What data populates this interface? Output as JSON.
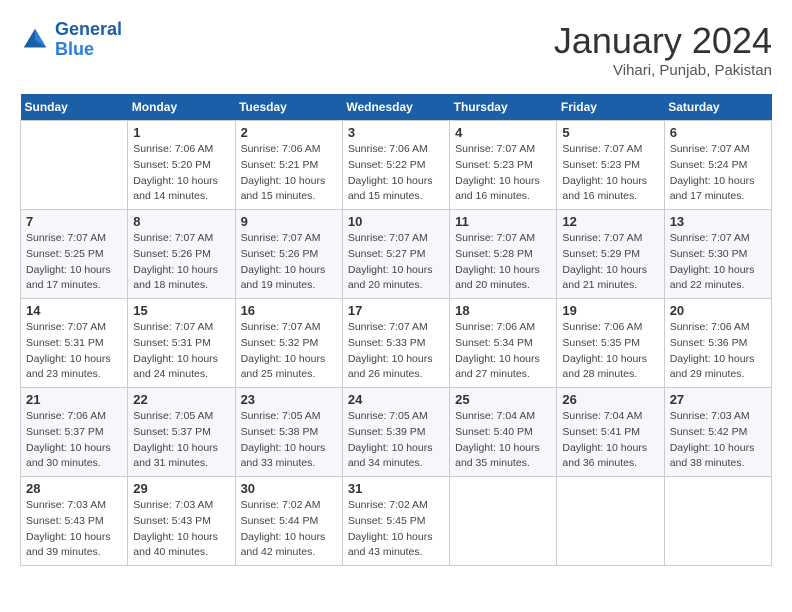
{
  "header": {
    "logo_line1": "General",
    "logo_line2": "Blue",
    "month_title": "January 2024",
    "subtitle": "Vihari, Punjab, Pakistan"
  },
  "days_of_week": [
    "Sunday",
    "Monday",
    "Tuesday",
    "Wednesday",
    "Thursday",
    "Friday",
    "Saturday"
  ],
  "weeks": [
    [
      {
        "day": "",
        "info": ""
      },
      {
        "day": "1",
        "info": "Sunrise: 7:06 AM\nSunset: 5:20 PM\nDaylight: 10 hours\nand 14 minutes."
      },
      {
        "day": "2",
        "info": "Sunrise: 7:06 AM\nSunset: 5:21 PM\nDaylight: 10 hours\nand 15 minutes."
      },
      {
        "day": "3",
        "info": "Sunrise: 7:06 AM\nSunset: 5:22 PM\nDaylight: 10 hours\nand 15 minutes."
      },
      {
        "day": "4",
        "info": "Sunrise: 7:07 AM\nSunset: 5:23 PM\nDaylight: 10 hours\nand 16 minutes."
      },
      {
        "day": "5",
        "info": "Sunrise: 7:07 AM\nSunset: 5:23 PM\nDaylight: 10 hours\nand 16 minutes."
      },
      {
        "day": "6",
        "info": "Sunrise: 7:07 AM\nSunset: 5:24 PM\nDaylight: 10 hours\nand 17 minutes."
      }
    ],
    [
      {
        "day": "7",
        "info": "Sunrise: 7:07 AM\nSunset: 5:25 PM\nDaylight: 10 hours\nand 17 minutes."
      },
      {
        "day": "8",
        "info": "Sunrise: 7:07 AM\nSunset: 5:26 PM\nDaylight: 10 hours\nand 18 minutes."
      },
      {
        "day": "9",
        "info": "Sunrise: 7:07 AM\nSunset: 5:26 PM\nDaylight: 10 hours\nand 19 minutes."
      },
      {
        "day": "10",
        "info": "Sunrise: 7:07 AM\nSunset: 5:27 PM\nDaylight: 10 hours\nand 20 minutes."
      },
      {
        "day": "11",
        "info": "Sunrise: 7:07 AM\nSunset: 5:28 PM\nDaylight: 10 hours\nand 20 minutes."
      },
      {
        "day": "12",
        "info": "Sunrise: 7:07 AM\nSunset: 5:29 PM\nDaylight: 10 hours\nand 21 minutes."
      },
      {
        "day": "13",
        "info": "Sunrise: 7:07 AM\nSunset: 5:30 PM\nDaylight: 10 hours\nand 22 minutes."
      }
    ],
    [
      {
        "day": "14",
        "info": "Sunrise: 7:07 AM\nSunset: 5:31 PM\nDaylight: 10 hours\nand 23 minutes."
      },
      {
        "day": "15",
        "info": "Sunrise: 7:07 AM\nSunset: 5:31 PM\nDaylight: 10 hours\nand 24 minutes."
      },
      {
        "day": "16",
        "info": "Sunrise: 7:07 AM\nSunset: 5:32 PM\nDaylight: 10 hours\nand 25 minutes."
      },
      {
        "day": "17",
        "info": "Sunrise: 7:07 AM\nSunset: 5:33 PM\nDaylight: 10 hours\nand 26 minutes."
      },
      {
        "day": "18",
        "info": "Sunrise: 7:06 AM\nSunset: 5:34 PM\nDaylight: 10 hours\nand 27 minutes."
      },
      {
        "day": "19",
        "info": "Sunrise: 7:06 AM\nSunset: 5:35 PM\nDaylight: 10 hours\nand 28 minutes."
      },
      {
        "day": "20",
        "info": "Sunrise: 7:06 AM\nSunset: 5:36 PM\nDaylight: 10 hours\nand 29 minutes."
      }
    ],
    [
      {
        "day": "21",
        "info": "Sunrise: 7:06 AM\nSunset: 5:37 PM\nDaylight: 10 hours\nand 30 minutes."
      },
      {
        "day": "22",
        "info": "Sunrise: 7:05 AM\nSunset: 5:37 PM\nDaylight: 10 hours\nand 31 minutes."
      },
      {
        "day": "23",
        "info": "Sunrise: 7:05 AM\nSunset: 5:38 PM\nDaylight: 10 hours\nand 33 minutes."
      },
      {
        "day": "24",
        "info": "Sunrise: 7:05 AM\nSunset: 5:39 PM\nDaylight: 10 hours\nand 34 minutes."
      },
      {
        "day": "25",
        "info": "Sunrise: 7:04 AM\nSunset: 5:40 PM\nDaylight: 10 hours\nand 35 minutes."
      },
      {
        "day": "26",
        "info": "Sunrise: 7:04 AM\nSunset: 5:41 PM\nDaylight: 10 hours\nand 36 minutes."
      },
      {
        "day": "27",
        "info": "Sunrise: 7:03 AM\nSunset: 5:42 PM\nDaylight: 10 hours\nand 38 minutes."
      }
    ],
    [
      {
        "day": "28",
        "info": "Sunrise: 7:03 AM\nSunset: 5:43 PM\nDaylight: 10 hours\nand 39 minutes."
      },
      {
        "day": "29",
        "info": "Sunrise: 7:03 AM\nSunset: 5:43 PM\nDaylight: 10 hours\nand 40 minutes."
      },
      {
        "day": "30",
        "info": "Sunrise: 7:02 AM\nSunset: 5:44 PM\nDaylight: 10 hours\nand 42 minutes."
      },
      {
        "day": "31",
        "info": "Sunrise: 7:02 AM\nSunset: 5:45 PM\nDaylight: 10 hours\nand 43 minutes."
      },
      {
        "day": "",
        "info": ""
      },
      {
        "day": "",
        "info": ""
      },
      {
        "day": "",
        "info": ""
      }
    ]
  ]
}
